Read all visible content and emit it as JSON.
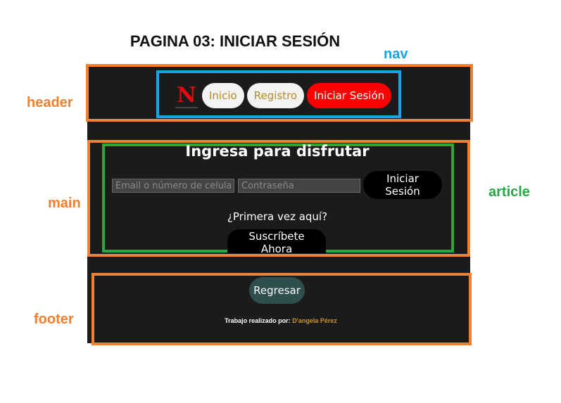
{
  "page_title": "PAGINA 03: INICIAR SESIÓN",
  "annotations": {
    "header": "header",
    "nav": "nav",
    "main": "main",
    "article": "article",
    "footer": "footer"
  },
  "nav": {
    "logo": "N",
    "items": [
      {
        "label": "Inicio"
      },
      {
        "label": "Registro"
      },
      {
        "label": "Iniciar Sesión"
      }
    ]
  },
  "login": {
    "title": "Ingresa para disfrutar",
    "email_placeholder": "Email o número de celular",
    "password_placeholder": "Contraseña",
    "submit_label": "Iniciar Sesión",
    "first_time": "¿Primera vez aquí?",
    "subscribe_label": "Suscríbete Ahora"
  },
  "footer": {
    "back_label": "Regresar",
    "credits_prefix": "Trabajo realizado por:",
    "author": "D'angela Pérez"
  },
  "colors": {
    "annotation_orange": "#f47f2d",
    "annotation_blue": "#1aa3e6",
    "annotation_green": "#27a845",
    "brand_red": "#e50914",
    "nav_active": "#ff0000"
  }
}
